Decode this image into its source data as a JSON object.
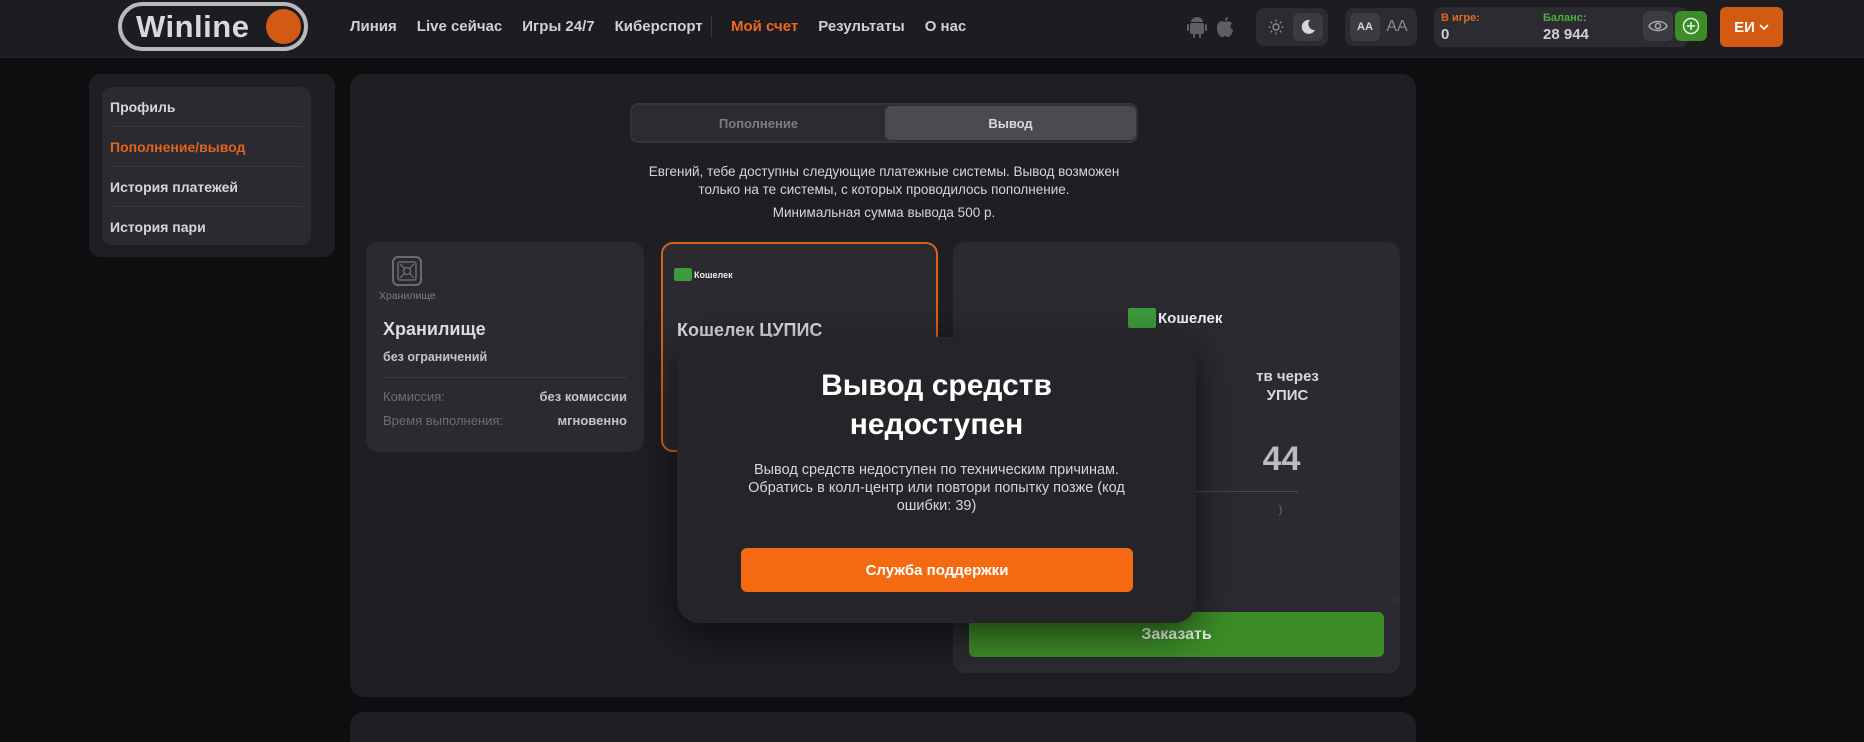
{
  "header": {
    "logo_text": "Winline",
    "nav": [
      "Линия",
      "Live сейчас",
      "Игры 24/7",
      "Киберспорт"
    ],
    "nav_right": [
      "Мой счет",
      "Результаты",
      "О нас"
    ],
    "font_small": "AA",
    "font_big": "AA",
    "in_game_label": "В игре:",
    "in_game_value": "0",
    "balance_label": "Баланс:",
    "balance_value": "28 944",
    "user_initials": "ЕИ",
    "colors": {
      "accent": "#d35a12",
      "green": "#3c8c27"
    }
  },
  "sidebar": {
    "items": [
      "Профиль",
      "Пополнение/вывод",
      "История платежей",
      "История пари"
    ]
  },
  "main": {
    "tabs": [
      "Пополнение",
      "Вывод"
    ],
    "info": "Евгений, тебе доступны следующие платежные системы. Вывод возможен только на те системы, с которых проводилось пополнение.",
    "min_amount": "Минимальная сумма вывода 500 р.",
    "card1": {
      "caption": "Хранилище",
      "title": "Хранилище",
      "subtitle": "без ограничений",
      "fee_label": "Комиссия:",
      "fee_value": "без комиссии",
      "time_label": "Время выполнения:",
      "time_value": "мгновенно"
    },
    "card2": {
      "logo_text": "Кошелек",
      "title": "Кошелек ЦУПИС"
    },
    "card3": {
      "logo_text": "Кошелек",
      "text1": "тв через",
      "text2": "УПИС",
      "amount": "44",
      "small": ")",
      "button": "Заказать"
    }
  },
  "modal": {
    "title_line1": "Вывод средств",
    "title_line2": "недоступен",
    "text": "Вывод средств недоступен по техническим причинам. Обратись в колл-центр или повтори попытку позже (код ошибки: 39)",
    "button": "Служба поддержки"
  }
}
